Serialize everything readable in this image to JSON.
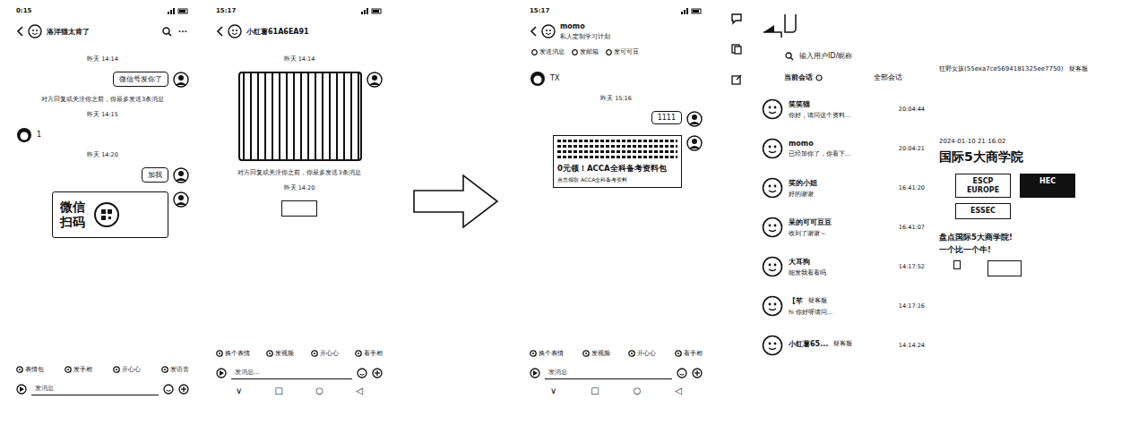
{
  "chats": [
    {
      "status_time": "0:15",
      "title": "洛洋猫太肯了",
      "subtitle": "",
      "more": "···",
      "quick": [],
      "items": [
        {
          "kind": "time",
          "text": "昨天 14:14"
        },
        {
          "kind": "sent",
          "text": "微信号发你了"
        },
        {
          "kind": "notice",
          "text": "对方回复或关注你之前，你最多发送3条消息"
        },
        {
          "kind": "time",
          "text": "昨天 14:15"
        },
        {
          "kind": "received",
          "text": "1"
        },
        {
          "kind": "time",
          "text": "昨天 14:20"
        },
        {
          "kind": "sent",
          "text": "加我"
        },
        {
          "kind": "image",
          "text": "微信扫码"
        }
      ],
      "toolbar": [
        "表情包",
        "发手相",
        "开心心",
        "发语音"
      ],
      "input": "发消息",
      "nav": []
    },
    {
      "status_time": "15:17",
      "title": "小红薯61A6EA91",
      "subtitle": "",
      "more": "",
      "quick": [],
      "items": [
        {
          "kind": "time",
          "text": "昨天 14:14"
        },
        {
          "kind": "photo"
        },
        {
          "kind": "notice",
          "text": "对方回复或关注你之前，你最多发送3条消息"
        },
        {
          "kind": "time",
          "text": "昨天 14:20"
        },
        {
          "kind": "blank"
        }
      ],
      "toolbar": [
        "换个表情",
        "发视频",
        "开心心",
        "看手相"
      ],
      "input": "发消息...",
      "nav": [
        "∨",
        "□",
        "○",
        "◁"
      ]
    },
    {
      "status_time": "15:17",
      "title": "momo",
      "subtitle": "私人定制学习计划",
      "more": "",
      "quick": [
        "发送消息",
        "发邮箱",
        "发可可豆"
      ],
      "items": [
        {
          "kind": "received",
          "text": "TX"
        },
        {
          "kind": "time",
          "text": "昨天 15:16"
        },
        {
          "kind": "sent",
          "text": "1111"
        },
        {
          "kind": "card",
          "title": "0元领！ACCA全科备考资料包",
          "text": "点击领取 ACCA全科备考资料"
        }
      ],
      "toolbar": [
        "换个表情",
        "发视频",
        "开心心",
        "看手相"
      ],
      "input": "发消息",
      "nav": [
        "∨",
        "□",
        "○",
        "◁"
      ]
    }
  ],
  "conversations": {
    "search": {
      "placeholder": "输入用户ID/昵称"
    },
    "tabs": [
      {
        "label": "当前会话",
        "selected": true
      },
      {
        "label": "全部会话",
        "selected": false
      }
    ],
    "rows": [
      {
        "name": "笑笑猫",
        "preview": "你好，请问这个资料...",
        "time": "20:04:44",
        "tag": ""
      },
      {
        "name": "momo",
        "preview": "已经加你了，你看下...",
        "time": "20:04:21",
        "tag": ""
      },
      {
        "name": "笑的小姐",
        "preview": "好的谢谢",
        "time": "16:41:20",
        "tag": ""
      },
      {
        "name": "呆的可可豆豆",
        "preview": "收到了谢谢～",
        "time": "16:41:07",
        "tag": ""
      },
      {
        "name": "大耳狗",
        "preview": "能发我看看吗",
        "time": "14:17:52",
        "tag": ""
      },
      {
        "name": "【芊",
        "preview": "hi 你好呀请问...",
        "time": "14:17:16",
        "tag": "疑客服"
      },
      {
        "name": "小红薯65...",
        "preview": "",
        "time": "14:14:24",
        "tag": "疑客服"
      }
    ]
  },
  "detail": {
    "name": "狂野女孩(55exa7ce5694181325ee7750)",
    "tag": "疑客服",
    "time": "2024-01-10 21:16:02",
    "title": "国际5大商学院",
    "logos": [
      "ESCP EUROPE",
      "HEC",
      "ESSEC"
    ],
    "caption": [
      "盘点国际5大商学院!",
      "一个比一个牛!"
    ]
  }
}
